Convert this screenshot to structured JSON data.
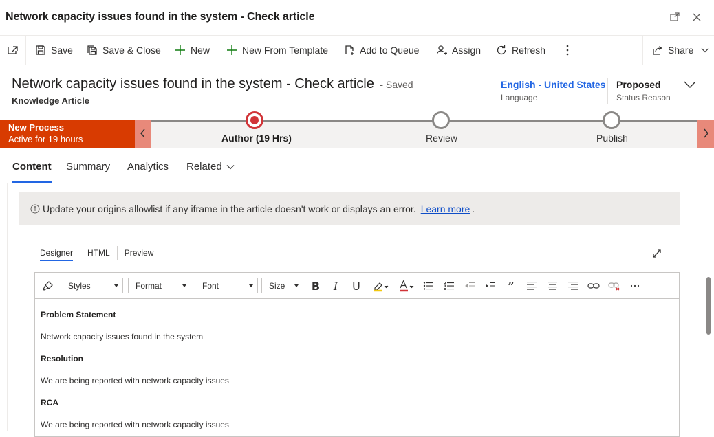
{
  "window": {
    "title": "Network capacity issues found in the system - Check article"
  },
  "commands": {
    "save": "Save",
    "save_close": "Save & Close",
    "new": "New",
    "new_from_template": "New From Template",
    "add_to_queue": "Add to Queue",
    "assign": "Assign",
    "refresh": "Refresh",
    "share": "Share"
  },
  "header": {
    "title": "Network capacity issues found in the system - Check article",
    "saved": "- Saved",
    "entity": "Knowledge Article",
    "language_value": "English - United States",
    "language_label": "Language",
    "status_value": "Proposed",
    "status_label": "Status Reason"
  },
  "process": {
    "name": "New Process",
    "active": "Active for 19 hours",
    "stages": [
      "Author  (19 Hrs)",
      "Review",
      "Publish"
    ]
  },
  "tabs": [
    "Content",
    "Summary",
    "Analytics",
    "Related"
  ],
  "notice": {
    "text": "Update your origins allowlist if any iframe in the article doesn't work or displays an error.",
    "link": "Learn more",
    "end": "."
  },
  "editor": {
    "tabs": [
      "Designer",
      "HTML",
      "Preview"
    ],
    "dropdowns": [
      "Styles",
      "Format",
      "Font",
      "Size"
    ],
    "content": [
      {
        "kind": "heading",
        "text": "Problem Statement"
      },
      {
        "kind": "para",
        "text": "Network capacity issues found in the system"
      },
      {
        "kind": "heading",
        "text": "Resolution"
      },
      {
        "kind": "para",
        "text": "We are being reported with network capacity issues"
      },
      {
        "kind": "heading",
        "text": "RCA"
      },
      {
        "kind": "para",
        "text": "We are being reported with network capacity issues"
      }
    ]
  },
  "colors": {
    "process_red": "#d83b01",
    "active_stage": "#d13438",
    "link_blue": "#2266e3",
    "add_green": "#107c10"
  },
  "icons": {
    "toolbar": [
      "brush-icon",
      "bold-icon",
      "italic-icon",
      "underline-icon",
      "highlight-icon",
      "font-color-icon",
      "bullet-list-icon",
      "numbered-list-icon",
      "outdent-icon",
      "indent-icon",
      "quote-icon",
      "align-left-icon",
      "align-center-icon",
      "align-right-icon",
      "link-icon",
      "unlink-icon",
      "more-icon"
    ]
  }
}
